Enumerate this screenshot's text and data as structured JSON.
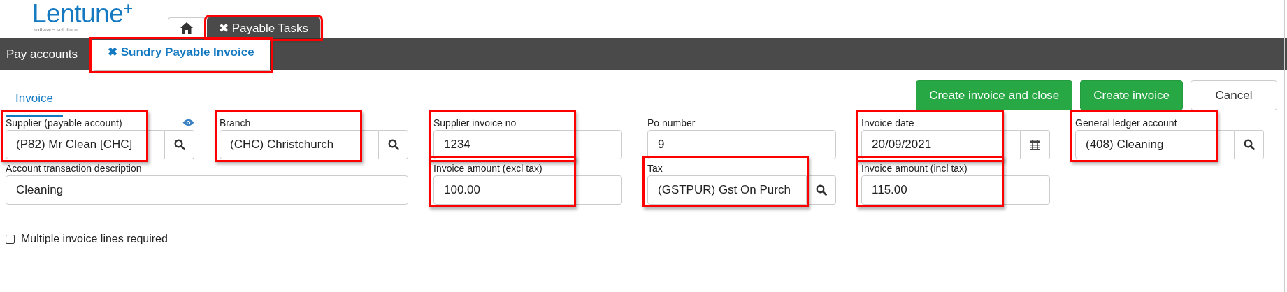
{
  "logo": {
    "name": "Lentune$^{+}$",
    "tagline": "software solutions"
  },
  "top_tabs": [
    {
      "kind": "home",
      "selected": false,
      "highlighted": false
    },
    {
      "kind": "text",
      "label": "Payable Tasks",
      "close": "✖",
      "selected": true,
      "highlighted": true
    }
  ],
  "sub_nav": [
    {
      "label": "Pay accounts",
      "selected": false,
      "highlighted": false
    },
    {
      "label": "Sundry Payable Invoice",
      "close": "✖",
      "selected": true,
      "highlighted": true
    }
  ],
  "section_tabs": [
    {
      "label": "Invoice",
      "selected": true
    }
  ],
  "buttons": [
    {
      "label": "Create invoice and close",
      "kind": "primary"
    },
    {
      "label": "Create invoice",
      "kind": "primary"
    },
    {
      "label": "Cancel",
      "kind": "default"
    }
  ],
  "fields": [
    {
      "label": "Supplier (payable account)",
      "value": "(P82) Mr Clean [CHC]",
      "kind": "search",
      "highlighted": true,
      "reveal_toggle": true
    },
    {
      "label": "Branch",
      "value": "(CHC) Christchurch",
      "kind": "search",
      "highlighted": true,
      "reveal_toggle": false
    },
    {
      "label": "Supplier invoice no",
      "value": "1234",
      "kind": "text",
      "highlighted": true,
      "reveal_toggle": false
    },
    {
      "label": "Po number",
      "value": "9",
      "kind": "text",
      "highlighted": false,
      "reveal_toggle": false
    },
    {
      "label": "Invoice date",
      "value": "20/09/2021",
      "kind": "date",
      "highlighted": true,
      "reveal_toggle": false
    },
    {
      "label": "General ledger account",
      "value": "(408) Cleaning",
      "kind": "search",
      "highlighted": true,
      "reveal_toggle": false
    },
    {
      "label": "Account transaction description",
      "value": "Cleaning",
      "kind": "text",
      "highlighted": false,
      "reveal_toggle": false
    },
    {
      "label": "Invoice amount (excl tax)",
      "value": "100.00",
      "kind": "text",
      "highlighted": true,
      "reveal_toggle": false
    },
    {
      "label": "Tax",
      "value": "(GSTPUR) Gst On Purch",
      "kind": "search",
      "highlighted": true,
      "reveal_toggle": false
    },
    {
      "label": "Invoice amount (incl tax)",
      "value": "115.00",
      "kind": "text",
      "highlighted": true,
      "reveal_toggle": false
    }
  ],
  "multiple_lines": {
    "label": "Multiple invoice lines required",
    "checked": false
  }
}
